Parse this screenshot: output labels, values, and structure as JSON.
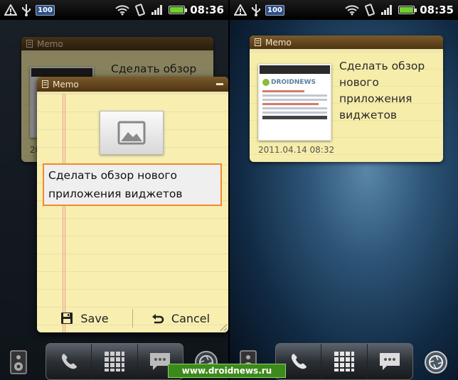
{
  "status_bar": {
    "left_time": "08:36",
    "right_time": "08:35",
    "badge": "100",
    "battery_level": 1.0
  },
  "widget": {
    "title": "Memo",
    "note_text": "Сделать обзор нового приложения виджетов",
    "date": "2011.04.14 08:32",
    "thumb_logo": "DROIDNEWS"
  },
  "dialog": {
    "title": "Memo",
    "input_value": "Сделать обзор нового приложения виджетов",
    "save_label": "Save",
    "cancel_label": "Cancel"
  },
  "background_widget": {
    "title": "Memo",
    "text_fragment": "Сделать обзор",
    "date_fragment": "201"
  },
  "watermark": "www.droidnews.ru",
  "colors": {
    "status_bar": "#000000",
    "battery": "#6fd12a",
    "memo_paper": "#f6edaa",
    "memo_header": "#5a3e18",
    "input_focus": "#f08a2c",
    "watermark": "#3d8a1c"
  },
  "icons": {
    "status_left": [
      "warning-icon",
      "usb-icon",
      "battery-100-badge"
    ],
    "status_right": [
      "wifi-icon",
      "rotate-icon",
      "signal-icon",
      "battery-icon"
    ],
    "dock": [
      "speaker-icon",
      "phone-icon",
      "grid-icon",
      "message-icon",
      "camera-shutter-icon"
    ]
  }
}
